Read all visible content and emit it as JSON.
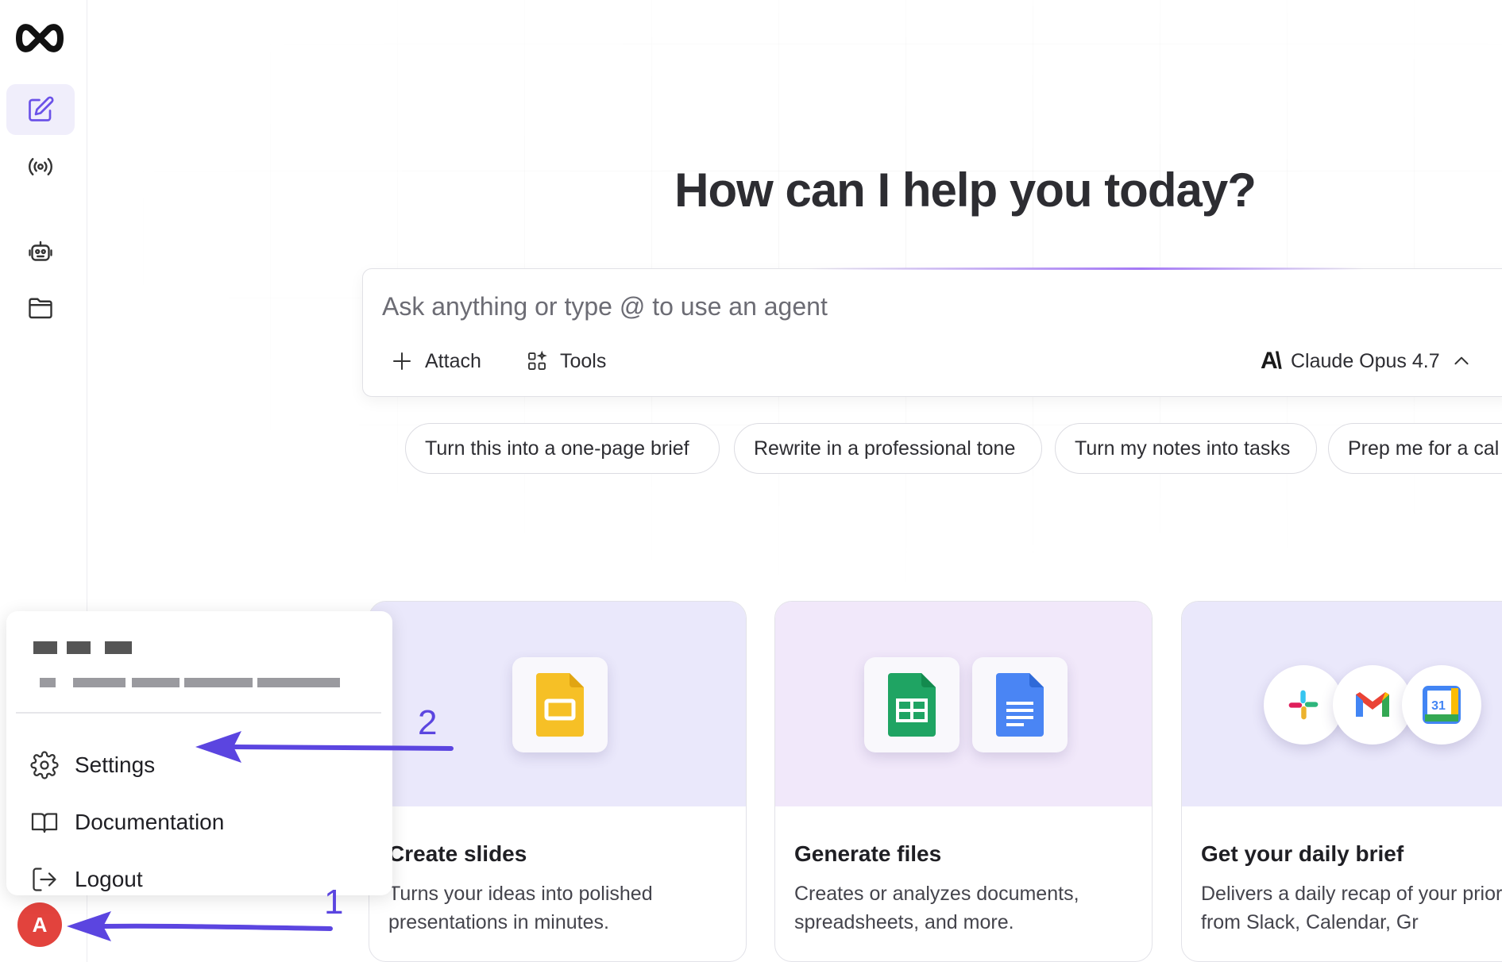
{
  "sidebar": {
    "logo": "infinity-logo",
    "items": [
      {
        "icon": "edit-icon",
        "active": true
      },
      {
        "icon": "broadcast-icon"
      },
      {
        "icon": "robot-icon"
      },
      {
        "icon": "folder-icon"
      }
    ],
    "avatar_initial": "A",
    "avatar_color": "#e2433d"
  },
  "main": {
    "headline": "How can I help you today?",
    "composer": {
      "placeholder": "Ask anything or type @ to use an agent",
      "attach_label": "Attach",
      "tools_label": "Tools",
      "model_logo": "A\\",
      "model_name": "Claude Opus 4.7"
    },
    "suggestions": [
      "Turn this into a one-page brief",
      "Rewrite in a professional tone",
      "Turn my notes into tasks",
      "Prep me for a cal"
    ],
    "cards": [
      {
        "title": "Create slides",
        "desc": "Turns your ideas into polished presentations in minutes.",
        "icons": [
          "google-slides-icon"
        ]
      },
      {
        "title": "Generate files",
        "desc": "Creates or analyzes documents, spreadsheets, and more.",
        "icons": [
          "google-sheets-icon",
          "google-docs-icon"
        ]
      },
      {
        "title": "Get your daily brief",
        "desc": "Delivers a daily recap of your priorities from Slack, Calendar, Gr",
        "icons": [
          "slack-icon",
          "gmail-icon",
          "google-calendar-icon"
        ],
        "calendar_day": "31"
      }
    ]
  },
  "user_menu": {
    "items": [
      {
        "label": "Settings",
        "icon": "gear-icon"
      },
      {
        "label": "Documentation",
        "icon": "book-icon"
      },
      {
        "label": "Logout",
        "icon": "logout-icon"
      }
    ]
  },
  "annotations": {
    "step1": "1",
    "step2": "2",
    "arrow_color": "#5b45e0"
  },
  "colors": {
    "accent": "#7c5cf0",
    "active_bg": "#f0eefb",
    "card_top_purple": "#eae8fb",
    "card_top_pink": "#f1e8fa"
  }
}
